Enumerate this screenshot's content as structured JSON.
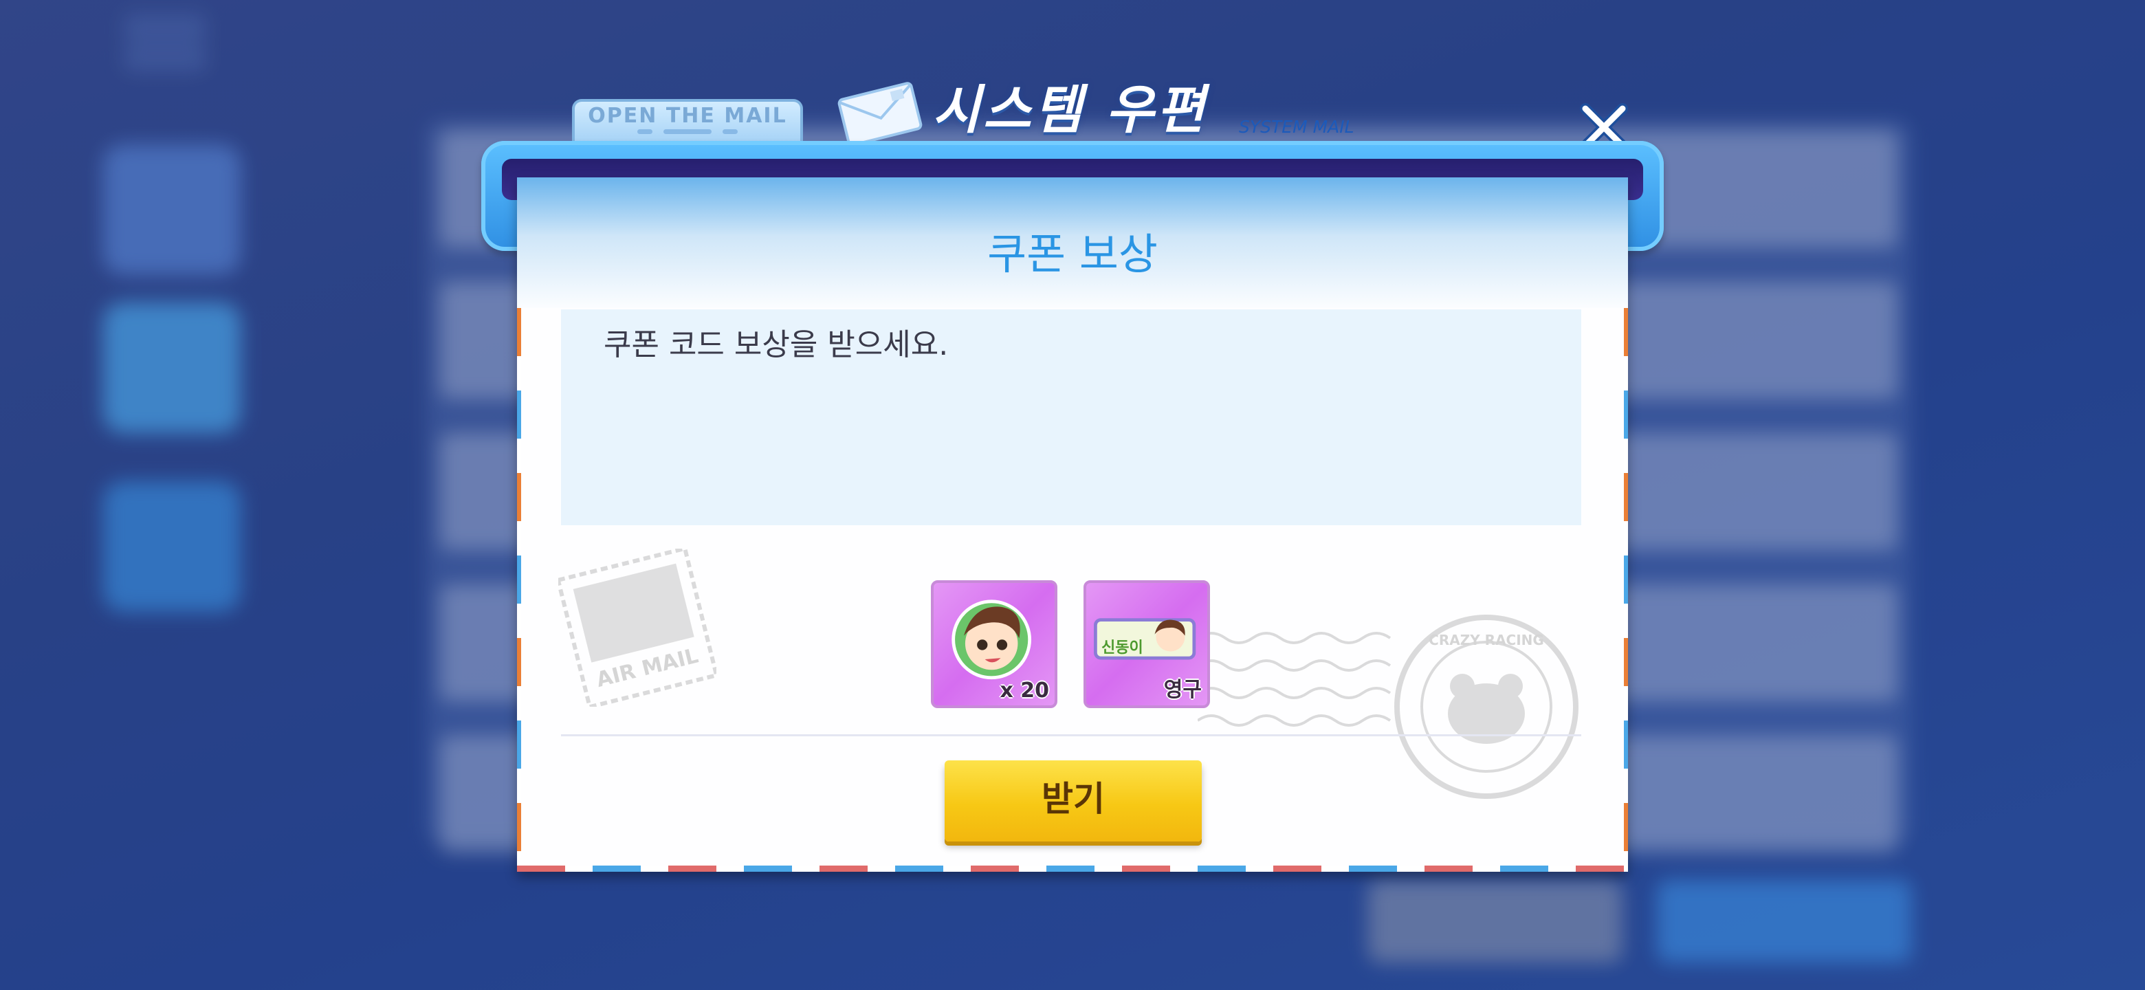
{
  "header": {
    "tab_label": "OPEN THE MAIL",
    "title": "시스템 우편",
    "subtitle": "SYSTEM MAIL"
  },
  "mail": {
    "title": "쿠폰 보상",
    "message": "쿠폰 코드 보상을 받으세요.",
    "stamp_text": "AIR MAIL",
    "postmark_text": "CRAZY RACING"
  },
  "rewards": [
    {
      "icon": "character-emoticon-icon",
      "quantity": "x 20"
    },
    {
      "icon": "nameplate-icon",
      "nameplate_label": "신동이",
      "duration": "영구"
    }
  ],
  "actions": {
    "receive_label": "받기"
  },
  "colors": {
    "title_blue": "#2a95e4",
    "button_yellow": "#f7c815",
    "item_purple": "#d56df0",
    "frame_blue": "#3b9df0"
  }
}
